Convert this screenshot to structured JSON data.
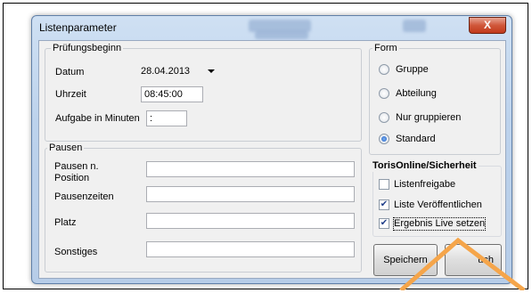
{
  "window": {
    "title": "Listenparameter",
    "close_label": "X"
  },
  "pruefungsbeginn": {
    "title": "Prüfungsbeginn",
    "datum_label": "Datum",
    "datum_value": "28.04.2013",
    "uhrzeit_label": "Uhrzeit",
    "uhrzeit_value": "08:45:00",
    "aufgabe_label": "Aufgabe in Minuten",
    "aufgabe_value": ":"
  },
  "pausen": {
    "title": "Pausen",
    "fields": [
      {
        "label": "Pausen n. Position",
        "value": ""
      },
      {
        "label": "Pausenzeiten",
        "value": ""
      },
      {
        "label": "Platz",
        "value": ""
      },
      {
        "label": "Sonstiges",
        "value": ""
      }
    ]
  },
  "form": {
    "title": "Form",
    "options": [
      {
        "label": "Gruppe",
        "selected": false
      },
      {
        "label": "Abteilung",
        "selected": false
      },
      {
        "label": "Nur gruppieren",
        "selected": false
      },
      {
        "label": "Standard",
        "selected": true
      }
    ]
  },
  "toris": {
    "title": "TorisOnline/Sicherheit",
    "options": [
      {
        "label": "Listenfreigabe",
        "checked": false
      },
      {
        "label": "Liste Veröffentlichen",
        "checked": true
      },
      {
        "label": "Ergebnis Live setzen",
        "checked": true
      }
    ]
  },
  "buttons": {
    "save_label": "Speichern",
    "second_label": "uch"
  },
  "colors": {
    "annotation_arrow": "#f5a54a",
    "title_bar": "#bcd2ec",
    "close_button": "#c9472a"
  }
}
